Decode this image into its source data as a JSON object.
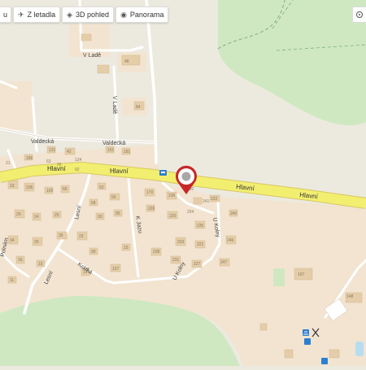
{
  "toolbar": {
    "partial_label": "u",
    "from_airport": "Z letadla",
    "view_3d": "3D pohled",
    "panorama": "Panorama"
  },
  "icons": {
    "airplane": "airplane-icon",
    "cube": "cube-icon",
    "eye": "eye-icon",
    "marker": "location-pin-icon"
  },
  "streets": {
    "hlavni": "Hlavní",
    "valdecka": "Valdecká",
    "v_lade": "V Ladě",
    "k_jazu": "K Jazu",
    "lesni": "Lesní",
    "kratka": "Krátká",
    "u_kolny": "U Kolny",
    "polnam": "Polnám"
  },
  "house_numbers": [
    "48",
    "84",
    "122",
    "42",
    "151",
    "181",
    "186",
    "124",
    "92",
    "33",
    "106",
    "170",
    "236",
    "220",
    "226",
    "241",
    "222",
    "235",
    "240",
    "221",
    "233",
    "238",
    "231",
    "227",
    "246",
    "247",
    "167",
    "107",
    "15",
    "52",
    "56",
    "58",
    "93",
    "95",
    "20",
    "24",
    "25",
    "34",
    "29",
    "35",
    "23",
    "16",
    "15",
    "19",
    "11",
    "99",
    "100",
    "66",
    "63",
    "26",
    "230",
    "224",
    "148",
    "21"
  ],
  "colors": {
    "land": "#eceadf",
    "built": "#f2e4d0",
    "building": "#e4cda8",
    "forest": "#cfe8c2",
    "main_road": "#f2ee70",
    "minor_road": "#ffffff",
    "marker": "#c62828"
  }
}
